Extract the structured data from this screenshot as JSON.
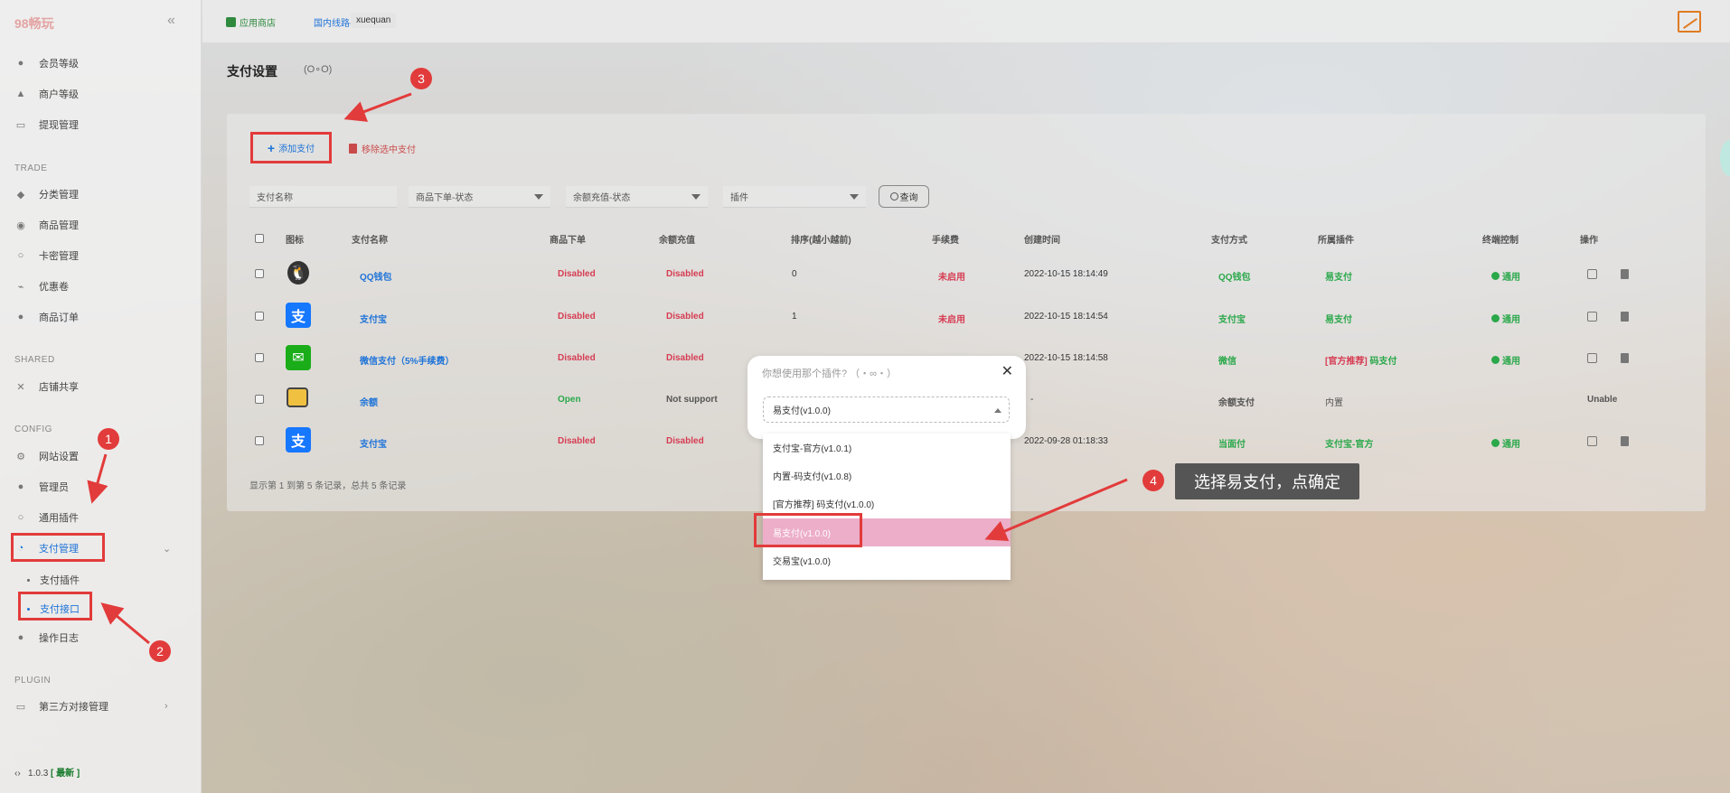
{
  "sidebar": {
    "logo": "98畅玩",
    "collapse_icon": "«",
    "top_items": [
      {
        "label": "会员等级",
        "icon": "users-icon"
      },
      {
        "label": "商户等级",
        "icon": "rocket-icon"
      },
      {
        "label": "提现管理",
        "icon": "withdraw-icon"
      }
    ],
    "sections": {
      "trade": "TRADE",
      "shared": "SHARED",
      "config": "CONFIG",
      "plugin": "PLUGIN"
    },
    "trade_items": [
      {
        "label": "分类管理",
        "icon": "category-icon"
      },
      {
        "label": "商品管理",
        "icon": "goods-icon"
      },
      {
        "label": "卡密管理",
        "icon": "card-icon"
      },
      {
        "label": "优惠卷",
        "icon": "coupon-icon"
      },
      {
        "label": "商品订单",
        "icon": "order-icon"
      }
    ],
    "shared_items": [
      {
        "label": "店铺共享",
        "icon": "share-icon"
      }
    ],
    "config_items": [
      {
        "label": "网站设置",
        "icon": "gear-icon"
      },
      {
        "label": "管理员",
        "icon": "admin-icon"
      },
      {
        "label": "通用插件",
        "icon": "plugin-icon"
      },
      {
        "label": "支付管理",
        "icon": "payment-icon"
      }
    ],
    "pay_sub_items": [
      "支付插件",
      "支付接口"
    ],
    "log_item": "操作日志",
    "plugin_items": [
      {
        "label": "第三方对接管理",
        "icon": "monitor-icon"
      }
    ],
    "version": "1.0.3",
    "version_tag": "[ 最新 ]"
  },
  "topbar": {
    "store": "应用商店",
    "line": "国内线路-1 ⌄",
    "user": "xuequan"
  },
  "page": {
    "title": "支付设置",
    "emoticon": "(O∘O)",
    "add_button": "添加支付",
    "remove_button": "移除选中支付",
    "filters": {
      "name_placeholder": "支付名称",
      "order_status": "商品下单-状态",
      "recharge_status": "余额充值-状态",
      "plugin": "插件"
    },
    "query_button": "查询"
  },
  "table": {
    "headers": [
      "图标",
      "支付名称",
      "商品下单",
      "余额充值",
      "排序(越小越前)",
      "手续费",
      "创建时间",
      "支付方式",
      "所属插件",
      "终端控制",
      "操作"
    ],
    "rows": [
      {
        "icon": "qq-icon",
        "name": "QQ钱包",
        "order": "Disabled",
        "recharge": "Disabled",
        "sort": "0",
        "fee": "未启用",
        "created": "2022-10-15 18:14:49",
        "method": "QQ钱包",
        "plugin": "易支付",
        "terminal": "通用",
        "actions": true
      },
      {
        "icon": "alipay-icon",
        "name": "支付宝",
        "order": "Disabled",
        "recharge": "Disabled",
        "sort": "1",
        "fee": "未启用",
        "created": "2022-10-15 18:14:54",
        "method": "支付宝",
        "plugin": "易支付",
        "terminal": "通用",
        "actions": true
      },
      {
        "icon": "wechat-icon",
        "name": "微信支付（5%手续费）",
        "order": "Disabled",
        "recharge": "Disabled",
        "sort": "",
        "fee": "",
        "created": "2022-10-15 18:14:58",
        "method": "微信",
        "plugin_tag": "[官方推荐]",
        "plugin": "码支付",
        "terminal": "通用",
        "actions": true
      },
      {
        "icon": "wallet-icon",
        "name": "余额",
        "order": "Open",
        "recharge": "Not support",
        "sort": "",
        "fee": "",
        "created": "-",
        "method": "余额支付",
        "plugin": "内置",
        "terminal": "",
        "actions_text": "Unable"
      },
      {
        "icon": "alipay-icon",
        "name": "支付宝",
        "order": "Disabled",
        "recharge": "Disabled",
        "sort": "",
        "fee": "",
        "created": "2022-09-28 01:18:33",
        "method": "当面付",
        "plugin": "支付宝-官方",
        "terminal": "通用",
        "actions": true
      }
    ],
    "pager": "显示第 1 到第 5 条记录，总共 5 条记录"
  },
  "modal": {
    "title": "你想使用那个插件? （・∞・）",
    "close": "✕",
    "selected": "易支付(v1.0.0)",
    "options": [
      "支付宝-官方(v1.0.1)",
      "内置-码支付(v1.0.8)",
      "[官方推荐] 码支付(v1.0.0)",
      "易支付(v1.0.0)",
      "交易宝(v1.0.0)"
    ]
  },
  "annotations": {
    "badges": [
      "1",
      "2",
      "3",
      "4"
    ],
    "tooltip": "选择易支付，点确定"
  },
  "colors": {
    "accent": "#1e73d8",
    "annotation_red": "#e23b3b",
    "selected_option": "#ecaec9",
    "disabled_red": "#d63c52",
    "green": "#2aa84a"
  }
}
